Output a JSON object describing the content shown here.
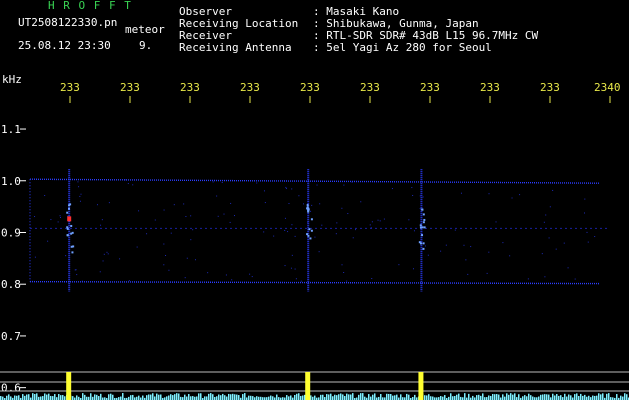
{
  "app": {
    "title": "H R O F F T",
    "file_name": "UT2508122330.pn",
    "mode_label": "meteor",
    "timestamp": "25.08.12 23:30",
    "count": "9."
  },
  "station": {
    "fields": [
      {
        "label": "Observer",
        "value": ": Masaki Kano"
      },
      {
        "label": "Receiving Location",
        "value": ": Shibukawa, Gunma, Japan"
      },
      {
        "label": "Receiver",
        "value": ": RTL-SDR SDR# 43dB L15 96.7MHz CW"
      },
      {
        "label": "Receiving Antenna",
        "value": ": 5el Yagi Az 280 for Seoul"
      }
    ]
  },
  "chart_data": {
    "type": "heatmap",
    "y_unit": "kHz",
    "x_ticks": [
      "233",
      "233",
      "233",
      "233",
      "233",
      "233",
      "233",
      "233",
      "233",
      "2340"
    ],
    "y_ticks": [
      "1.1",
      "1.0",
      "0.9",
      "0.8",
      "0.7",
      "0.6"
    ],
    "y_values": [
      1.1,
      1.0,
      0.9,
      0.8,
      0.7,
      0.6
    ],
    "ylim": [
      0.58,
      1.16
    ],
    "band_khz": [
      0.805,
      1.003
    ],
    "carrier_khz": 0.908,
    "meteor_columns": [
      0.11,
      0.49,
      0.67
    ],
    "colors": {
      "background": "#000000",
      "noise": "#2a3cff",
      "strong": "#ff3030",
      "level": "#7ff0ff",
      "peak": "#ffff30",
      "axis_text": "#e8e84a"
    }
  }
}
